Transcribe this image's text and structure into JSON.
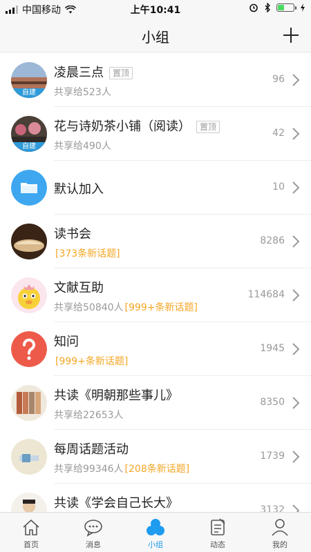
{
  "status": {
    "carrier": "中国移动",
    "time": "上午10:41"
  },
  "header": {
    "title": "小组"
  },
  "groups": [
    {
      "name": "凌晨三点",
      "pin": "置顶",
      "badge": "自建",
      "shared": "共享给523人",
      "new_topics": "",
      "count": "96",
      "avatar_color": "#c98a6a"
    },
    {
      "name": "花与诗奶茶小铺（阅读）",
      "pin": "置顶",
      "badge": "自建",
      "shared": "共享给490人",
      "new_topics": "",
      "count": "42",
      "avatar_color": "#6b5a4a"
    },
    {
      "name": "默认加入",
      "pin": "",
      "badge": "",
      "shared": "",
      "new_topics": "",
      "count": "10",
      "avatar_color": "#3ea7f0"
    },
    {
      "name": "读书会",
      "pin": "",
      "badge": "",
      "shared": "",
      "new_topics": "[373条新话题]",
      "count": "8286",
      "avatar_color": "#5a3a22"
    },
    {
      "name": "文献互助",
      "pin": "",
      "badge": "",
      "shared": "共享给50840人",
      "new_topics": "[999+条新话题]",
      "count": "114684",
      "avatar_color": "#f4d23a"
    },
    {
      "name": "知问",
      "pin": "",
      "badge": "",
      "shared": "",
      "new_topics": "[999+条新话题]",
      "count": "1945",
      "avatar_color": "#ee5a4a"
    },
    {
      "name": "共读《明朝那些事儿》",
      "pin": "",
      "badge": "",
      "shared": "共享给22653人",
      "new_topics": "",
      "count": "8350",
      "avatar_color": "#b87b57"
    },
    {
      "name": "每周话题活动",
      "pin": "",
      "badge": "",
      "shared": "共享给99346人",
      "new_topics": "[208条新话题]",
      "count": "1739",
      "avatar_color": "#e8e3d0"
    },
    {
      "name": "共读《学会自己长大》",
      "pin": "",
      "badge": "",
      "shared": "",
      "new_topics": "",
      "count": "3132",
      "avatar_color": "#d9c8b8"
    }
  ],
  "tabs": [
    {
      "label": "首页",
      "icon": "home-icon"
    },
    {
      "label": "消息",
      "icon": "message-icon"
    },
    {
      "label": "小组",
      "icon": "group-icon"
    },
    {
      "label": "动态",
      "icon": "feed-icon"
    },
    {
      "label": "我的",
      "icon": "profile-icon"
    }
  ]
}
